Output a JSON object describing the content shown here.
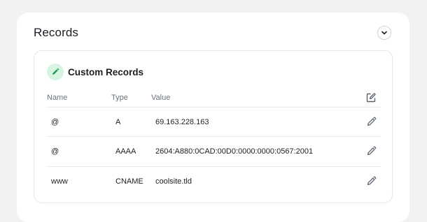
{
  "section": {
    "title": "Records"
  },
  "card": {
    "title": "Custom Records"
  },
  "table": {
    "columns": [
      "Name",
      "Type",
      "Value"
    ],
    "rows": [
      {
        "name": "@",
        "type": "A",
        "value": "69.163.228.163"
      },
      {
        "name": "@",
        "type": "AAAA",
        "value": "2604:A880:0CAD:00D0:0000:0000:0567:2001"
      },
      {
        "name": "www",
        "type": "CNAME",
        "value": "coolsite.tld"
      }
    ]
  },
  "icons": {
    "collapse": "chevron-down-icon",
    "card": "pencil-icon",
    "header_action": "edit-square-icon",
    "row_action": "pencil-icon"
  },
  "colors": {
    "accent": "#1f9d55",
    "accent_bg": "#d7f3e2",
    "icon": "#5b6470"
  }
}
